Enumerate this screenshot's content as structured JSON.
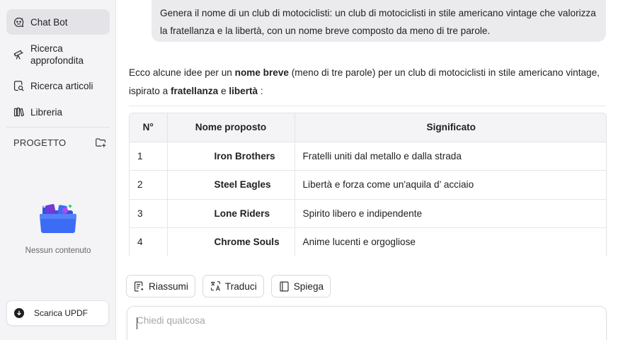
{
  "sidebar": {
    "items": [
      {
        "label": "Chat Bot",
        "icon": "chatbot-icon",
        "active": true
      },
      {
        "label": "Ricerca approfondita",
        "icon": "telescope-icon",
        "active": false
      },
      {
        "label": "Ricerca articoli",
        "icon": "article-search-icon",
        "active": false
      },
      {
        "label": "Libreria",
        "icon": "library-icon",
        "active": false
      }
    ],
    "project_label": "PROGETTO",
    "empty_text": "Nessun contenuto",
    "download_label": "Scarica UPDF"
  },
  "chat": {
    "user_message": "Genera il nome di un club di motociclisti: un club di motociclisti in stile americano vintage che valorizza la fratellanza e la libertà, con un nome breve composto da meno di tre parole.",
    "intro": {
      "p1": "Ecco alcune idee per un ",
      "b1": "nome breve",
      "p2": " (meno di tre parole) per un club di motociclisti in stile americano vintage, ispirato a ",
      "b2": "fratellanza",
      "p3": " e ",
      "b3": "libertà",
      "p4": " :"
    },
    "table": {
      "headers": [
        "N°",
        "Nome proposto",
        "Significato"
      ],
      "rows": [
        {
          "num": "1",
          "name": "Iron Brothers",
          "meaning": "Fratelli uniti dal metallo e dalla strada"
        },
        {
          "num": "2",
          "name": "Steel Eagles",
          "meaning": "Libertà e forza come un'aquila d’ acciaio"
        },
        {
          "num": "3",
          "name": "Lone Riders",
          "meaning": "Spirito libero e indipendente"
        },
        {
          "num": "4",
          "name": "Chrome Souls",
          "meaning": "Anime lucenti e orgogliose"
        }
      ]
    }
  },
  "actions": {
    "summarize": "Riassumi",
    "translate": "Traduci",
    "explain": "Spiega"
  },
  "input": {
    "placeholder": "Chiedi qualcosa",
    "value": ""
  },
  "colors": {
    "sidebar_bg": "#f4f4f6",
    "active_item_bg": "#e4e4e8",
    "user_bubble_bg": "#ebebee",
    "folder_blue": "#3b6cf5",
    "folder_accent": "#b44af0"
  }
}
